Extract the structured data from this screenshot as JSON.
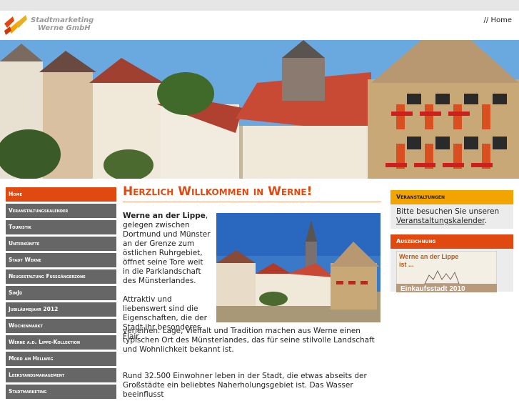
{
  "header": {
    "logo_line1": "Stadtmarketing",
    "logo_line2": "Werne GmbH",
    "home_link": "// Home"
  },
  "nav": {
    "items": [
      "Home",
      "Veranstaltungskalender",
      "Touristik",
      "Unterkünfte",
      "Stadt Werne",
      "Neugestaltung Fußgängerzone",
      "SimJü",
      "Jubiläumsjahr 2012",
      "Wochenmarkt",
      "Werne a.d. Lippe-Kollektion",
      "Mord am Hellweg",
      "Leerstandsmanagement",
      "Stadtmarketing"
    ],
    "active_index": 0
  },
  "main": {
    "title": "Herzlich Willkommen in Werne!",
    "intro_bold": "Werne an der Lippe",
    "intro_rest": ", gelegen zwischen Dortmund und Münster an der Grenze zum östlichen Ruhrgebiet, öffnet seine Tore weit in die Parklandschaft des Münsterlandes.",
    "para2_start": "Attraktiv und liebenswert sind die Eigenschaften, die der Stadt ihr besonderes Flair",
    "para2_end": "verleihen. Lage, Vielfalt und Tradition machen aus Werne einen typischen Ort des Münsterlandes, das für seine stilvolle Landschaft und Wohnlichkeit bekannt ist.",
    "para3": "Rund 32.500 Einwohner leben in der Stadt, die etwas abseits der Großstädte ein beliebtes Naherholungsgebiet ist. Das Wasser beeinflusst"
  },
  "sidebar_right": {
    "events_title": "Veranstaltungen",
    "events_text": "Bitte besuchen Sie unseren",
    "events_link": "Veranstaltungskalender",
    "events_tail": ".",
    "award_title": "Auszeichnung",
    "award_line1": "Werne an der Lippe",
    "award_line2": "ist ...",
    "award_line3": "Einkaufsstadt 2010"
  },
  "colors": {
    "accent_orange": "#e04a10",
    "accent_yellow": "#f2a400",
    "nav_gray": "#666666"
  }
}
